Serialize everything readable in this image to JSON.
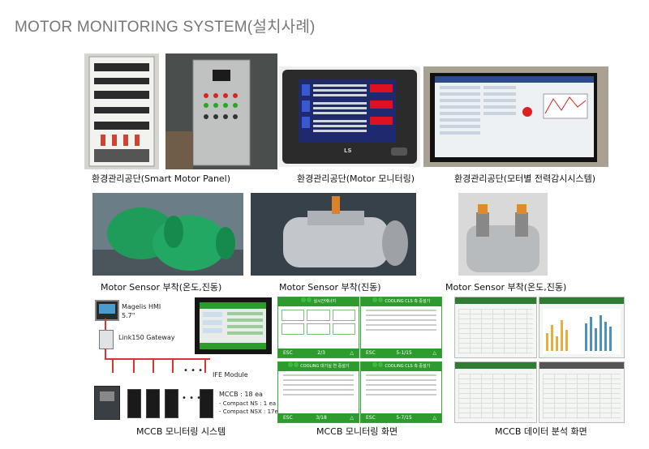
{
  "title": "MOTOR MONITORING SYSTEM(설치사례)",
  "captions": {
    "row1_left": "환경관리공단(Smart Motor Panel)",
    "row1_mid": "환경관리공단(Motor 모니터링)",
    "row1_right": "환경관리공단(모터별 전력감시시스템)",
    "row2_left": "Motor Sensor 부착(온도,진동)",
    "row2_mid": "Motor Sensor 부착(진동)",
    "row2_right": "Motor Sensor 부착(온도,진동)",
    "row3_left": "MCCB 모니터링 시스템",
    "row3_mid": "MCCB 모니터링 화면",
    "row3_right": "MCCB 데이터 분석 화면"
  },
  "diagram": {
    "hmi_label": "Magelis HMI",
    "hmi_size": "5.7\"",
    "gateway_label": "Link150 Gateway",
    "ife_label": "IFE Module",
    "dots": "• • •",
    "mccb_count": "MCCB : 18 ea",
    "mccb_ns": "- Compact NS : 1 ea",
    "mccb_nsx": "- Compact NSX : 17ea"
  },
  "screens": {
    "s1_title": "실시간에너지",
    "s1_footer_left": "ESC",
    "s1_footer_mid": "2/3",
    "s2_title": "COOLING CLS 측 중설기",
    "s2_footer_left": "ESC",
    "s2_footer_mid": "5-1/15",
    "s3_title": "COOLING 대기실 연 중설기",
    "s3_footer_left": "ESC",
    "s3_footer_mid": "3/18",
    "s4_title": "COOLING CLS 측 중설기",
    "s4_footer_left": "ESC",
    "s4_footer_mid": "5-7/15"
  },
  "photo_screen": {
    "brand": "LS"
  },
  "colors": {
    "screen_green": "#2e9b2e",
    "motor_green": "#1f9b5a",
    "bus_red": "#d33333"
  }
}
